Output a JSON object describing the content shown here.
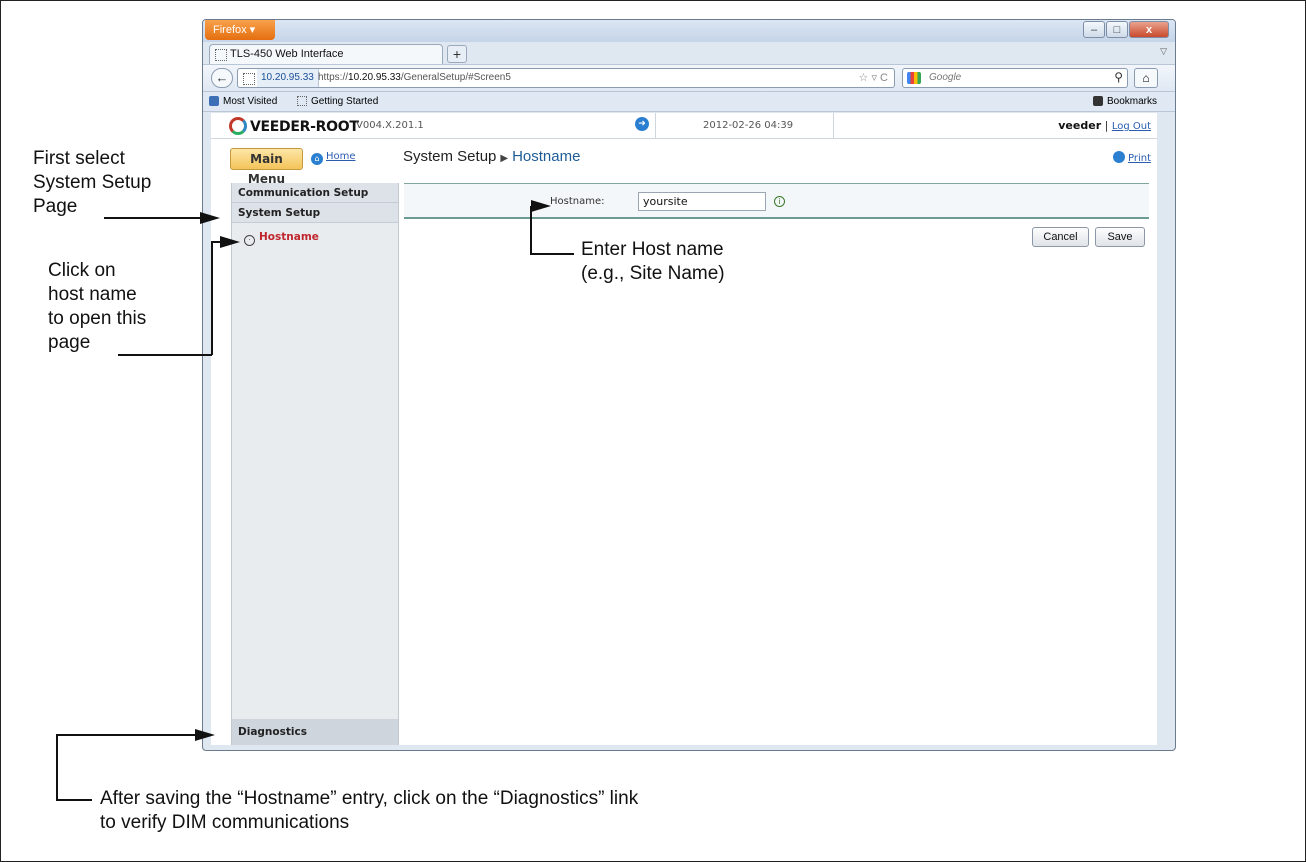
{
  "browser": {
    "menu_button": "Firefox ▾",
    "tab_title": "TLS-450 Web Interface",
    "new_tab": "+",
    "site_identity": "10.20.95.33",
    "url_prefix": "https://",
    "url_host": "10.20.95.33",
    "url_path": "/GeneralSetup/#Screen5",
    "url_tools": "☆ ▿ C",
    "search_placeholder": "Google",
    "bookmarks": [
      "Most Visited",
      "Getting Started"
    ],
    "bookmarks_menu": "Bookmarks"
  },
  "app": {
    "logo_text": "VEEDER-ROOT",
    "version": "V004.X.201.1",
    "datetime": "2012-02-26 04:39",
    "user": "veeder",
    "logout": "Log Out",
    "main_menu": "Main Menu",
    "home": "Home",
    "breadcrumb_parent": "System Setup",
    "breadcrumb_current": "Hostname",
    "print": "Print"
  },
  "sidebar": {
    "items": [
      "Communication Setup",
      "System Setup"
    ],
    "subitem": "Hostname",
    "bottom_item": "Diagnostics"
  },
  "form": {
    "hostname_label": "Hostname:",
    "hostname_value": "yoursite",
    "cancel": "Cancel",
    "save": "Save"
  },
  "annotations": {
    "first_select": [
      "First select",
      "System Setup",
      "Page"
    ],
    "click_host": [
      "Click on",
      "host name",
      "to open this",
      "page"
    ],
    "enter_host": [
      "Enter Host name",
      "(e.g., Site Name)"
    ],
    "after_saving": [
      "After saving the “Hostname” entry, click on the “Diagnostics” link",
      "to verify DIM communications"
    ]
  }
}
